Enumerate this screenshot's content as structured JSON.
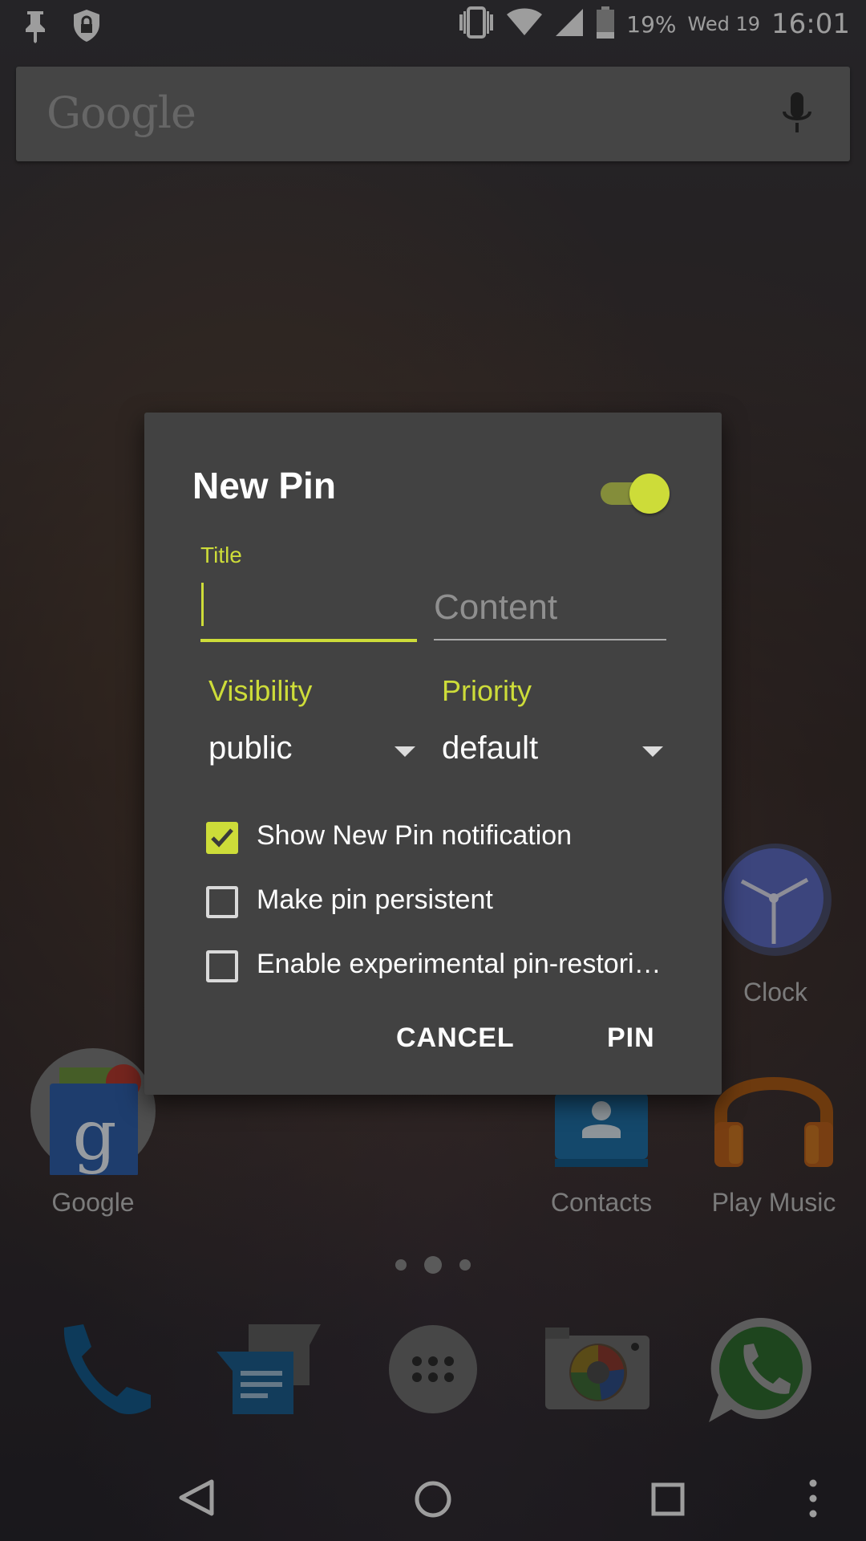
{
  "status_bar": {
    "battery_percent": "19%",
    "date": "Wed 19",
    "time": "16:01",
    "icons": [
      "pin-icon",
      "vpn-shield-icon",
      "vibrate-icon",
      "wifi-icon",
      "signal-icon",
      "battery-icon"
    ]
  },
  "search_bar": {
    "logo_text": "Google",
    "icons": [
      "mic-icon"
    ]
  },
  "home": {
    "apps": [
      {
        "label": "Clock",
        "icon": "clock-icon"
      },
      {
        "label": "Google",
        "icon": "google-folder-icon"
      },
      {
        "label": "Contacts",
        "icon": "contacts-icon"
      },
      {
        "label": "Play Music",
        "icon": "headphones-icon"
      }
    ],
    "page_indicator": {
      "pages": 3,
      "current": 2
    }
  },
  "dock": {
    "icons": [
      "phone-icon",
      "messenger-icon",
      "app-drawer-icon",
      "camera-icon",
      "whatsapp-icon"
    ]
  },
  "nav_bar": {
    "icons": [
      "back-icon",
      "home-icon",
      "recents-icon",
      "overflow-menu-icon"
    ]
  },
  "dialog": {
    "title": "New Pin",
    "enabled": true,
    "title_field": {
      "label": "Title",
      "value": ""
    },
    "content_field": {
      "placeholder": "Content",
      "value": ""
    },
    "visibility": {
      "label": "Visibility",
      "value": "public"
    },
    "priority": {
      "label": "Priority",
      "value": "default"
    },
    "options": [
      {
        "label": "Show New Pin notification",
        "checked": true
      },
      {
        "label": "Make pin persistent",
        "checked": false
      },
      {
        "label": "Enable experimental pin-restori…",
        "checked": false
      }
    ],
    "cancel_label": "CANCEL",
    "pin_label": "PIN"
  },
  "colors": {
    "accent": "#cddc39",
    "dialog_bg": "#424242"
  }
}
